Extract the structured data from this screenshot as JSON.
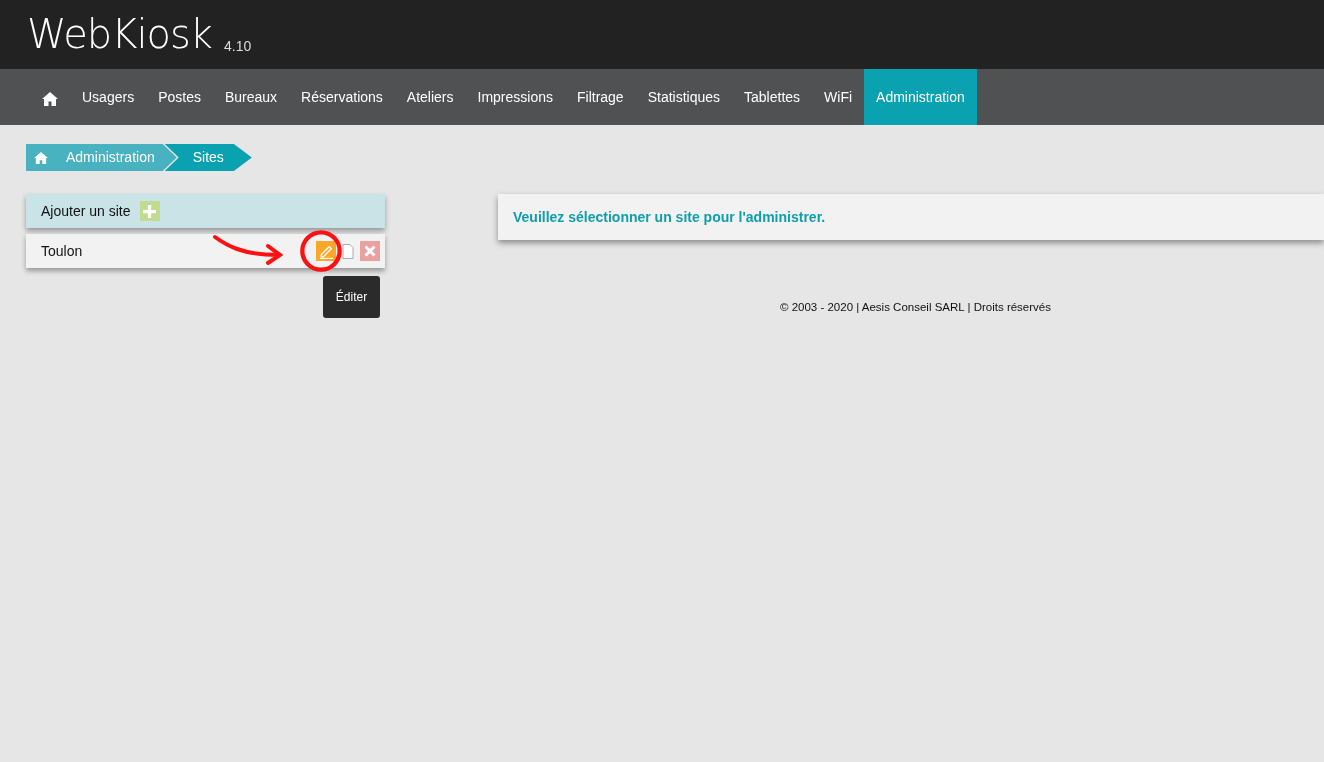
{
  "header": {
    "title": "WebKiosk",
    "version": "4.10"
  },
  "nav": [
    {
      "label": "Usagers",
      "selected": false
    },
    {
      "label": "Postes",
      "selected": false
    },
    {
      "label": "Bureaux",
      "selected": false
    },
    {
      "label": "Réservations",
      "selected": false
    },
    {
      "label": "Ateliers",
      "selected": false
    },
    {
      "label": "Impressions",
      "selected": false
    },
    {
      "label": "Filtrage",
      "selected": false
    },
    {
      "label": "Statistiques",
      "selected": false
    },
    {
      "label": "Tablettes",
      "selected": false
    },
    {
      "label": "WiFi",
      "selected": false
    },
    {
      "label": "Administration",
      "selected": true
    }
  ],
  "breadcrumb": [
    "Administration",
    "Sites"
  ],
  "add_site": {
    "label": "Ajouter un site"
  },
  "sites": [
    {
      "name": "Toulon",
      "highlighted": true
    }
  ],
  "tooltip": "Éditer",
  "message": "Veuillez sélectionner un site pour l'administrer.",
  "footer": "© 2003 - 2020 | Aesis Conseil SARL | Droits réservés"
}
